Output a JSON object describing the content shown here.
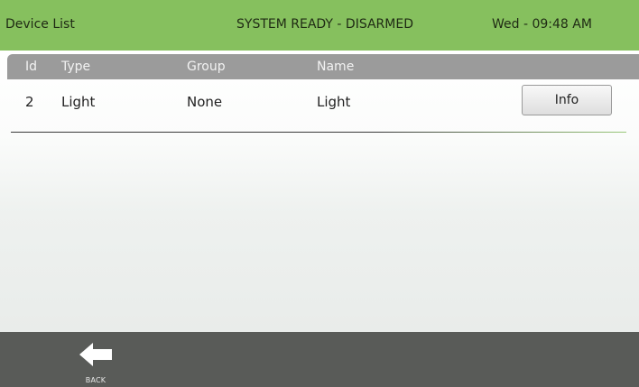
{
  "header": {
    "title": "Device List",
    "status": "SYSTEM READY - DISARMED",
    "datetime": "Wed - 09:48 AM"
  },
  "table": {
    "columns": [
      "Id",
      "Type",
      "Group",
      "Name"
    ],
    "rows": [
      {
        "id": "2",
        "type": "Light",
        "group": "None",
        "name": "Light",
        "action": "Info"
      }
    ]
  },
  "footer": {
    "back_label": "BACK",
    "back_icon": "arrow-left-icon"
  },
  "colors": {
    "header_bg": "#86c05e",
    "table_header_bg": "#9b9b9b",
    "footer_bg": "#595b58"
  }
}
